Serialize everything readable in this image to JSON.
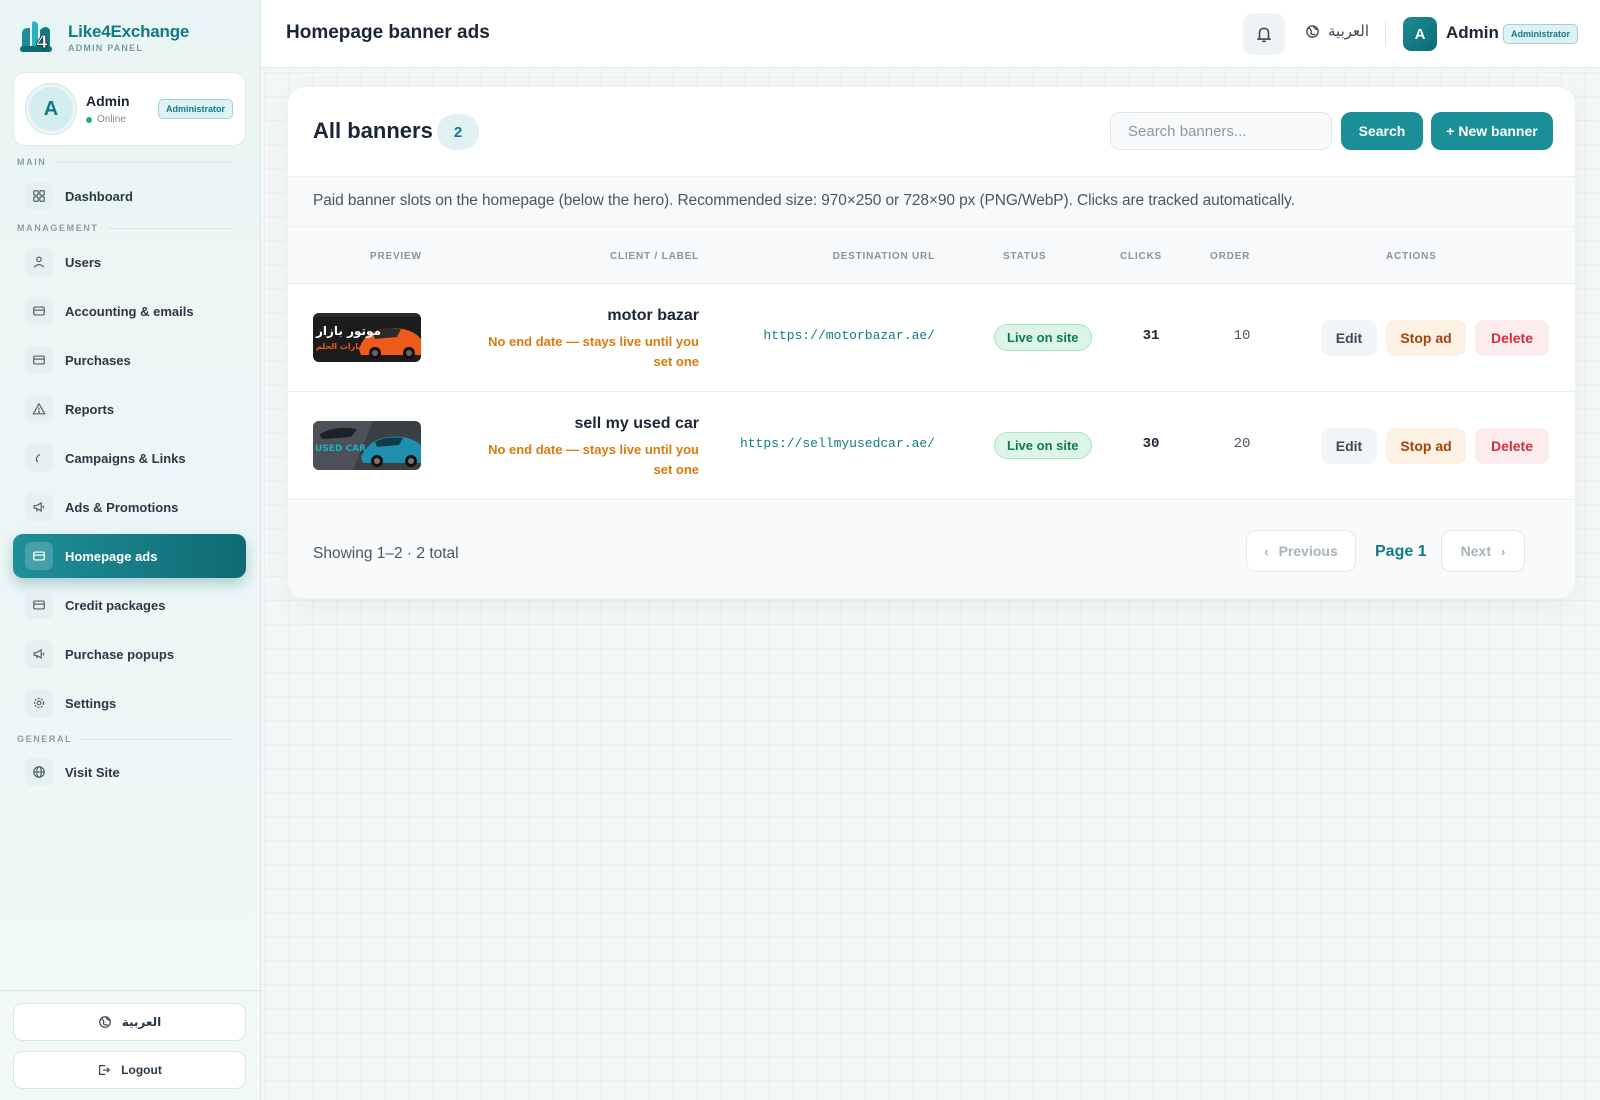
{
  "brand": {
    "name": "Like4Exchange",
    "subtitle": "ADMIN PANEL",
    "logo_text": "4"
  },
  "profile": {
    "initial": "A",
    "name": "Admin",
    "status": "Online",
    "role": "Administrator"
  },
  "nav": {
    "sections": {
      "main": "MAIN",
      "management": "MANAGEMENT",
      "general": "GENERAL"
    },
    "items": [
      {
        "label": "Dashboard",
        "icon": "grid-icon"
      },
      {
        "label": "Users",
        "icon": "users-icon"
      },
      {
        "label": "Accounting & emails",
        "icon": "card-icon"
      },
      {
        "label": "Purchases",
        "icon": "card-icon"
      },
      {
        "label": "Reports",
        "icon": "alert-triangle-icon"
      },
      {
        "label": "Campaigns & Links",
        "icon": "link-icon"
      },
      {
        "label": "Ads & Promotions",
        "icon": "megaphone-icon"
      },
      {
        "label": "Homepage ads",
        "icon": "card-icon",
        "active": true
      },
      {
        "label": "Credit packages",
        "icon": "card-icon"
      },
      {
        "label": "Purchase popups",
        "icon": "megaphone-icon"
      },
      {
        "label": "Settings",
        "icon": "gear-icon"
      },
      {
        "label": "Visit Site",
        "icon": "globe-icon"
      }
    ]
  },
  "sidebar_bottom": {
    "language": "العربية",
    "logout": "Logout"
  },
  "topbar": {
    "title": "Homepage banner ads",
    "language": "العربية",
    "user_initial": "A",
    "user_name": "Admin",
    "user_role": "Administrator"
  },
  "banners": {
    "title": "All banners",
    "count": "2",
    "search_placeholder": "Search banners...",
    "search_button": "Search",
    "new_button": "+ New banner",
    "hint": "Paid banner slots on the homepage (below the hero). Recommended size: 970×250 or 728×90 px (PNG/WebP). Clicks are tracked automatically.",
    "columns": {
      "preview": "PREVIEW",
      "client": "CLIENT / LABEL",
      "url": "DESTINATION URL",
      "status": "STATUS",
      "clicks": "CLICKS",
      "order": "ORDER",
      "actions": "ACTIONS"
    },
    "rows": [
      {
        "client": "motor bazar",
        "note": "No end date — stays live until you set one",
        "url": "https://motorbazar.ae/",
        "status": "Live on site",
        "clicks": "31",
        "order": "10",
        "thumb_text": "موتور بازار",
        "thumb_subtext": "سيارات الحلم",
        "thumb_colors": [
          "#1c1c1c",
          "#f05a1a"
        ]
      },
      {
        "client": "sell my used car",
        "note": "No end date — stays live until you set one",
        "url": "https://sellmyusedcar.ae/",
        "status": "Live on site",
        "clicks": "30",
        "order": "20",
        "thumb_text": "USED CAR",
        "thumb_subtext": "",
        "thumb_colors": [
          "#3a3f44",
          "#1f8fb0"
        ]
      }
    ],
    "actions": {
      "edit": "Edit",
      "stop": "Stop ad",
      "delete": "Delete"
    },
    "pagination": {
      "showing": "Showing 1–2 · 2 total",
      "previous": "Previous",
      "current": "Page 1",
      "next": "Next"
    }
  },
  "colors": {
    "accent": "#1a8f98",
    "accent_dark": "#0f6a74",
    "warning_text": "#d97a0e",
    "danger": "#d42e3b",
    "success_bg": "#dcf5e8"
  }
}
